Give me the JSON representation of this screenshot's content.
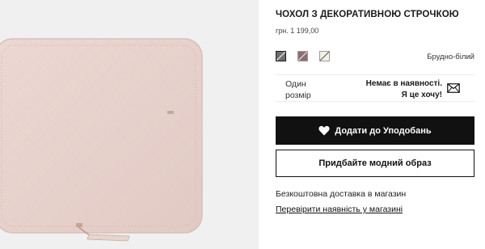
{
  "product": {
    "title": "ЧОХОЛ З ДЕКОРАТИВНОЮ СТРОЧКОЮ",
    "price": "грн. 1 199,00",
    "image_icon": "laptop-sleeve-photo"
  },
  "colors": {
    "selected_name": "Брудно-білий",
    "swatches": [
      {
        "name": "dark-grey",
        "hex": "#6e6e6e"
      },
      {
        "name": "mauve",
        "hex": "#8b6e70"
      },
      {
        "name": "off-white",
        "hex": "#f3f0e8"
      }
    ]
  },
  "size": {
    "label": "Один розмір",
    "stock_line1": "Немає в наявності.",
    "stock_line2": "Я це хочу!",
    "notify_icon": "envelope-icon"
  },
  "actions": {
    "favorite_label": "Додати до Уподобань",
    "favorite_icon": "heart-icon",
    "look_label": "Придбайте модний образ"
  },
  "info": {
    "shipping": "Безкоштовна доставка в магазин",
    "check_store": "Перевірити наявність у магазині"
  }
}
